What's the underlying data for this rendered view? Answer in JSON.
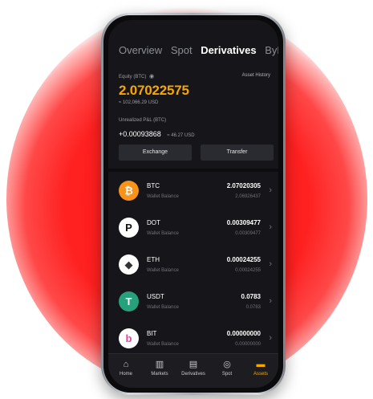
{
  "tabs": [
    "Overview",
    "Spot",
    "Derivatives",
    "ByFi"
  ],
  "active_tab": "Derivatives",
  "equity": {
    "label": "Equity (BTC)",
    "asset_history": "Asset History",
    "value": "2.07022575",
    "usd": "≈ 102,066.29 USD"
  },
  "pnl": {
    "label": "Unrealized P&L (BTC)",
    "value": "+0.00093868",
    "usd": "≈ 46.27 USD"
  },
  "buttons": {
    "exchange": "Exchange",
    "transfer": "Transfer"
  },
  "assets": [
    {
      "symbol": "BTC",
      "sub": "Wallet Balance",
      "amount": "2.07020305",
      "amount_sub": "2.06926437",
      "icon": "btc-icon",
      "color": "#f7931a"
    },
    {
      "symbol": "DOT",
      "sub": "Wallet Balance",
      "amount": "0.00309477",
      "amount_sub": "0.00309477",
      "icon": "dot-icon",
      "color": "#e6007a"
    },
    {
      "symbol": "ETH",
      "sub": "Wallet Balance",
      "amount": "0.00024255",
      "amount_sub": "0.00024255",
      "icon": "eth-icon",
      "color": "#ffffff"
    },
    {
      "symbol": "USDT",
      "sub": "Wallet Balance",
      "amount": "0.0783",
      "amount_sub": "0.0783",
      "icon": "usdt-icon",
      "color": "#26a17b"
    },
    {
      "symbol": "BIT",
      "sub": "Wallet Balance",
      "amount": "0.00000000",
      "amount_sub": "0.00000000",
      "icon": "bit-icon",
      "color": "#e9479b"
    }
  ],
  "nav": [
    {
      "label": "Home",
      "icon": "home-icon"
    },
    {
      "label": "Markets",
      "icon": "markets-icon"
    },
    {
      "label": "Derivatives",
      "icon": "derivatives-icon"
    },
    {
      "label": "Spot",
      "icon": "spot-icon"
    },
    {
      "label": "Assets",
      "icon": "wallet-icon",
      "active": true
    }
  ],
  "colors": {
    "accent": "#f7a600",
    "background": "#16161a",
    "glow": "#ff1a1a"
  }
}
